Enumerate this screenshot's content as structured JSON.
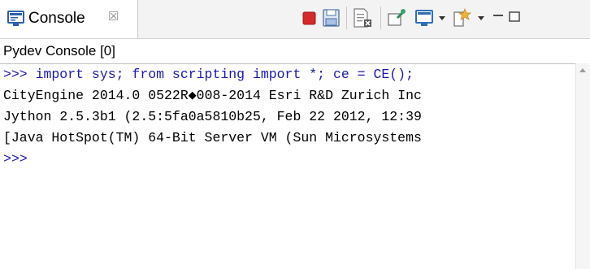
{
  "tab": {
    "label": "Console",
    "close_glyph": "☒"
  },
  "toolbar": {
    "items": [
      {
        "icon": "terminate-icon",
        "color": "#d22b2b"
      },
      {
        "icon": "save-icon",
        "color": "#4a7abf"
      },
      {
        "icon": "clear-console-icon",
        "color": "#6d6d6d"
      },
      {
        "icon": "pin-console-icon",
        "color": "#2e8b57"
      },
      {
        "icon": "display-selected-console-icon",
        "color": "#2f6fb5"
      },
      {
        "icon": "open-console-icon",
        "color": "#e0a030"
      }
    ],
    "window": {
      "minimize_glyph": "−",
      "maximize_glyph": "□"
    }
  },
  "console": {
    "title": "Pydev Console [0]",
    "lines": [
      {
        "type": "input",
        "text": ">>> import sys; from scripting import *; ce = CE();"
      },
      {
        "type": "output",
        "text": "CityEngine 2014.0 0522R◆008-2014 Esri R&D Zurich Inc"
      },
      {
        "type": "output",
        "text": "Jython 2.5.3b1 (2.5:5fa0a5810b25, Feb 22 2012, 12:39"
      },
      {
        "type": "output",
        "text": "[Java HotSpot(TM) 64-Bit Server VM (Sun Microsystems"
      },
      {
        "type": "input",
        "text": ">>>"
      }
    ]
  }
}
